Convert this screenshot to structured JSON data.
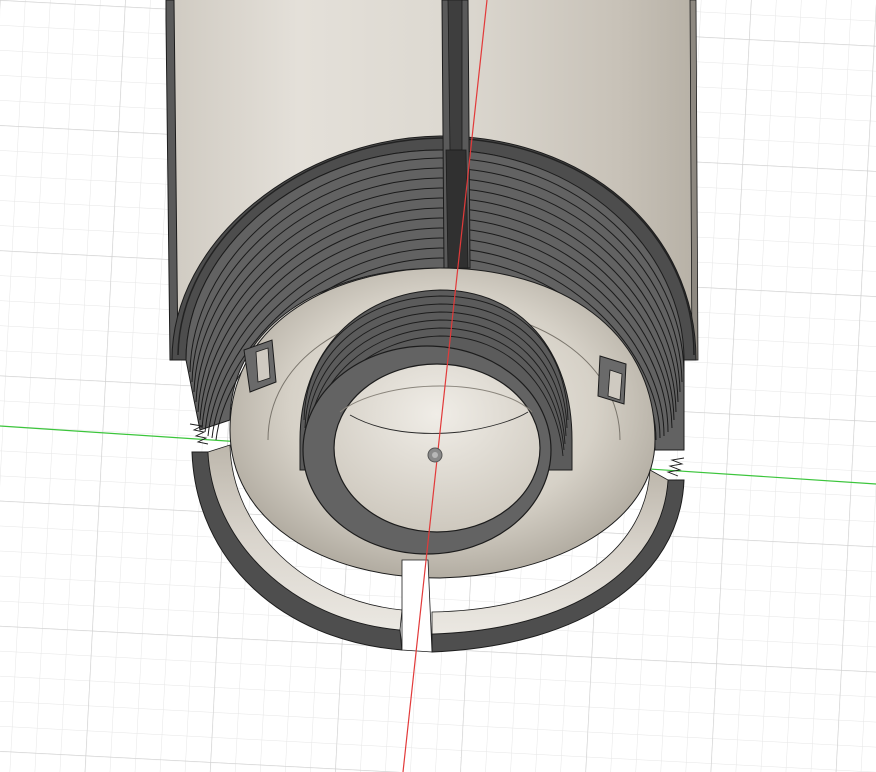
{
  "viewport": {
    "background": "#ffffff",
    "grid": {
      "visible": true,
      "minor_color": "#e4e4e4",
      "major_color": "#c9c9c9"
    }
  },
  "axes": {
    "x_axis_color": "#e03a3a",
    "y_axis_color": "#38c438"
  },
  "model": {
    "description_icon": "threaded-cylinder-section-icon",
    "body_light": "#d7d2c9",
    "body_mid": "#b9b3a8",
    "wall_dark": "#555555",
    "edge_color": "#1c1c1c",
    "origin_marker": "origin-point-icon"
  }
}
